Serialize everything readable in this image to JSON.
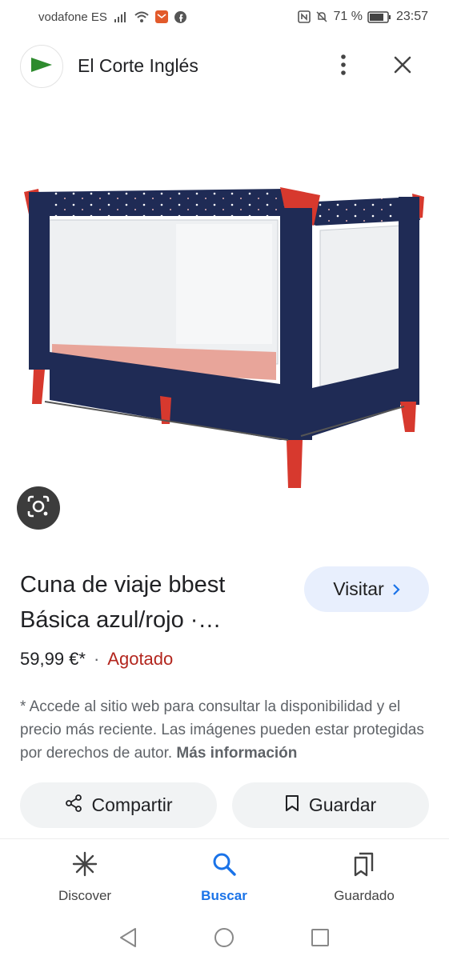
{
  "status_bar": {
    "carrier": "vodafone ES",
    "battery": "71 %",
    "time": "23:57"
  },
  "header": {
    "site_name": "El Corte Inglés",
    "logo_icon": "el-corte-ingles-flag-logo",
    "more_icon": "more-vert-icon",
    "close_icon": "close-icon"
  },
  "product": {
    "title": "Cuna de viaje bbest Básica azul/rojo ·…",
    "price": "59,99 €*",
    "separator": "·",
    "stock_status": "Agotado",
    "visit_label": "Visitar",
    "disclaimer": "* Accede al sitio web para consultar la disponibilidad y el precio más reciente. Las imágenes pueden estar protegidas por derechos de autor.",
    "more_info": "Más información"
  },
  "actions": {
    "share_label": "Compartir",
    "save_label": "Guardar"
  },
  "bottom_nav": {
    "items": [
      {
        "label": "Discover",
        "icon": "asterisk-icon",
        "active": false
      },
      {
        "label": "Buscar",
        "icon": "search-icon",
        "active": true
      },
      {
        "label": "Guardado",
        "icon": "bookmarks-icon",
        "active": false
      }
    ]
  },
  "colors": {
    "accent": "#1a73e8",
    "stock_red": "#b3261e",
    "visit_bg": "#e8effd",
    "logo_green": "#2e8b2e"
  }
}
